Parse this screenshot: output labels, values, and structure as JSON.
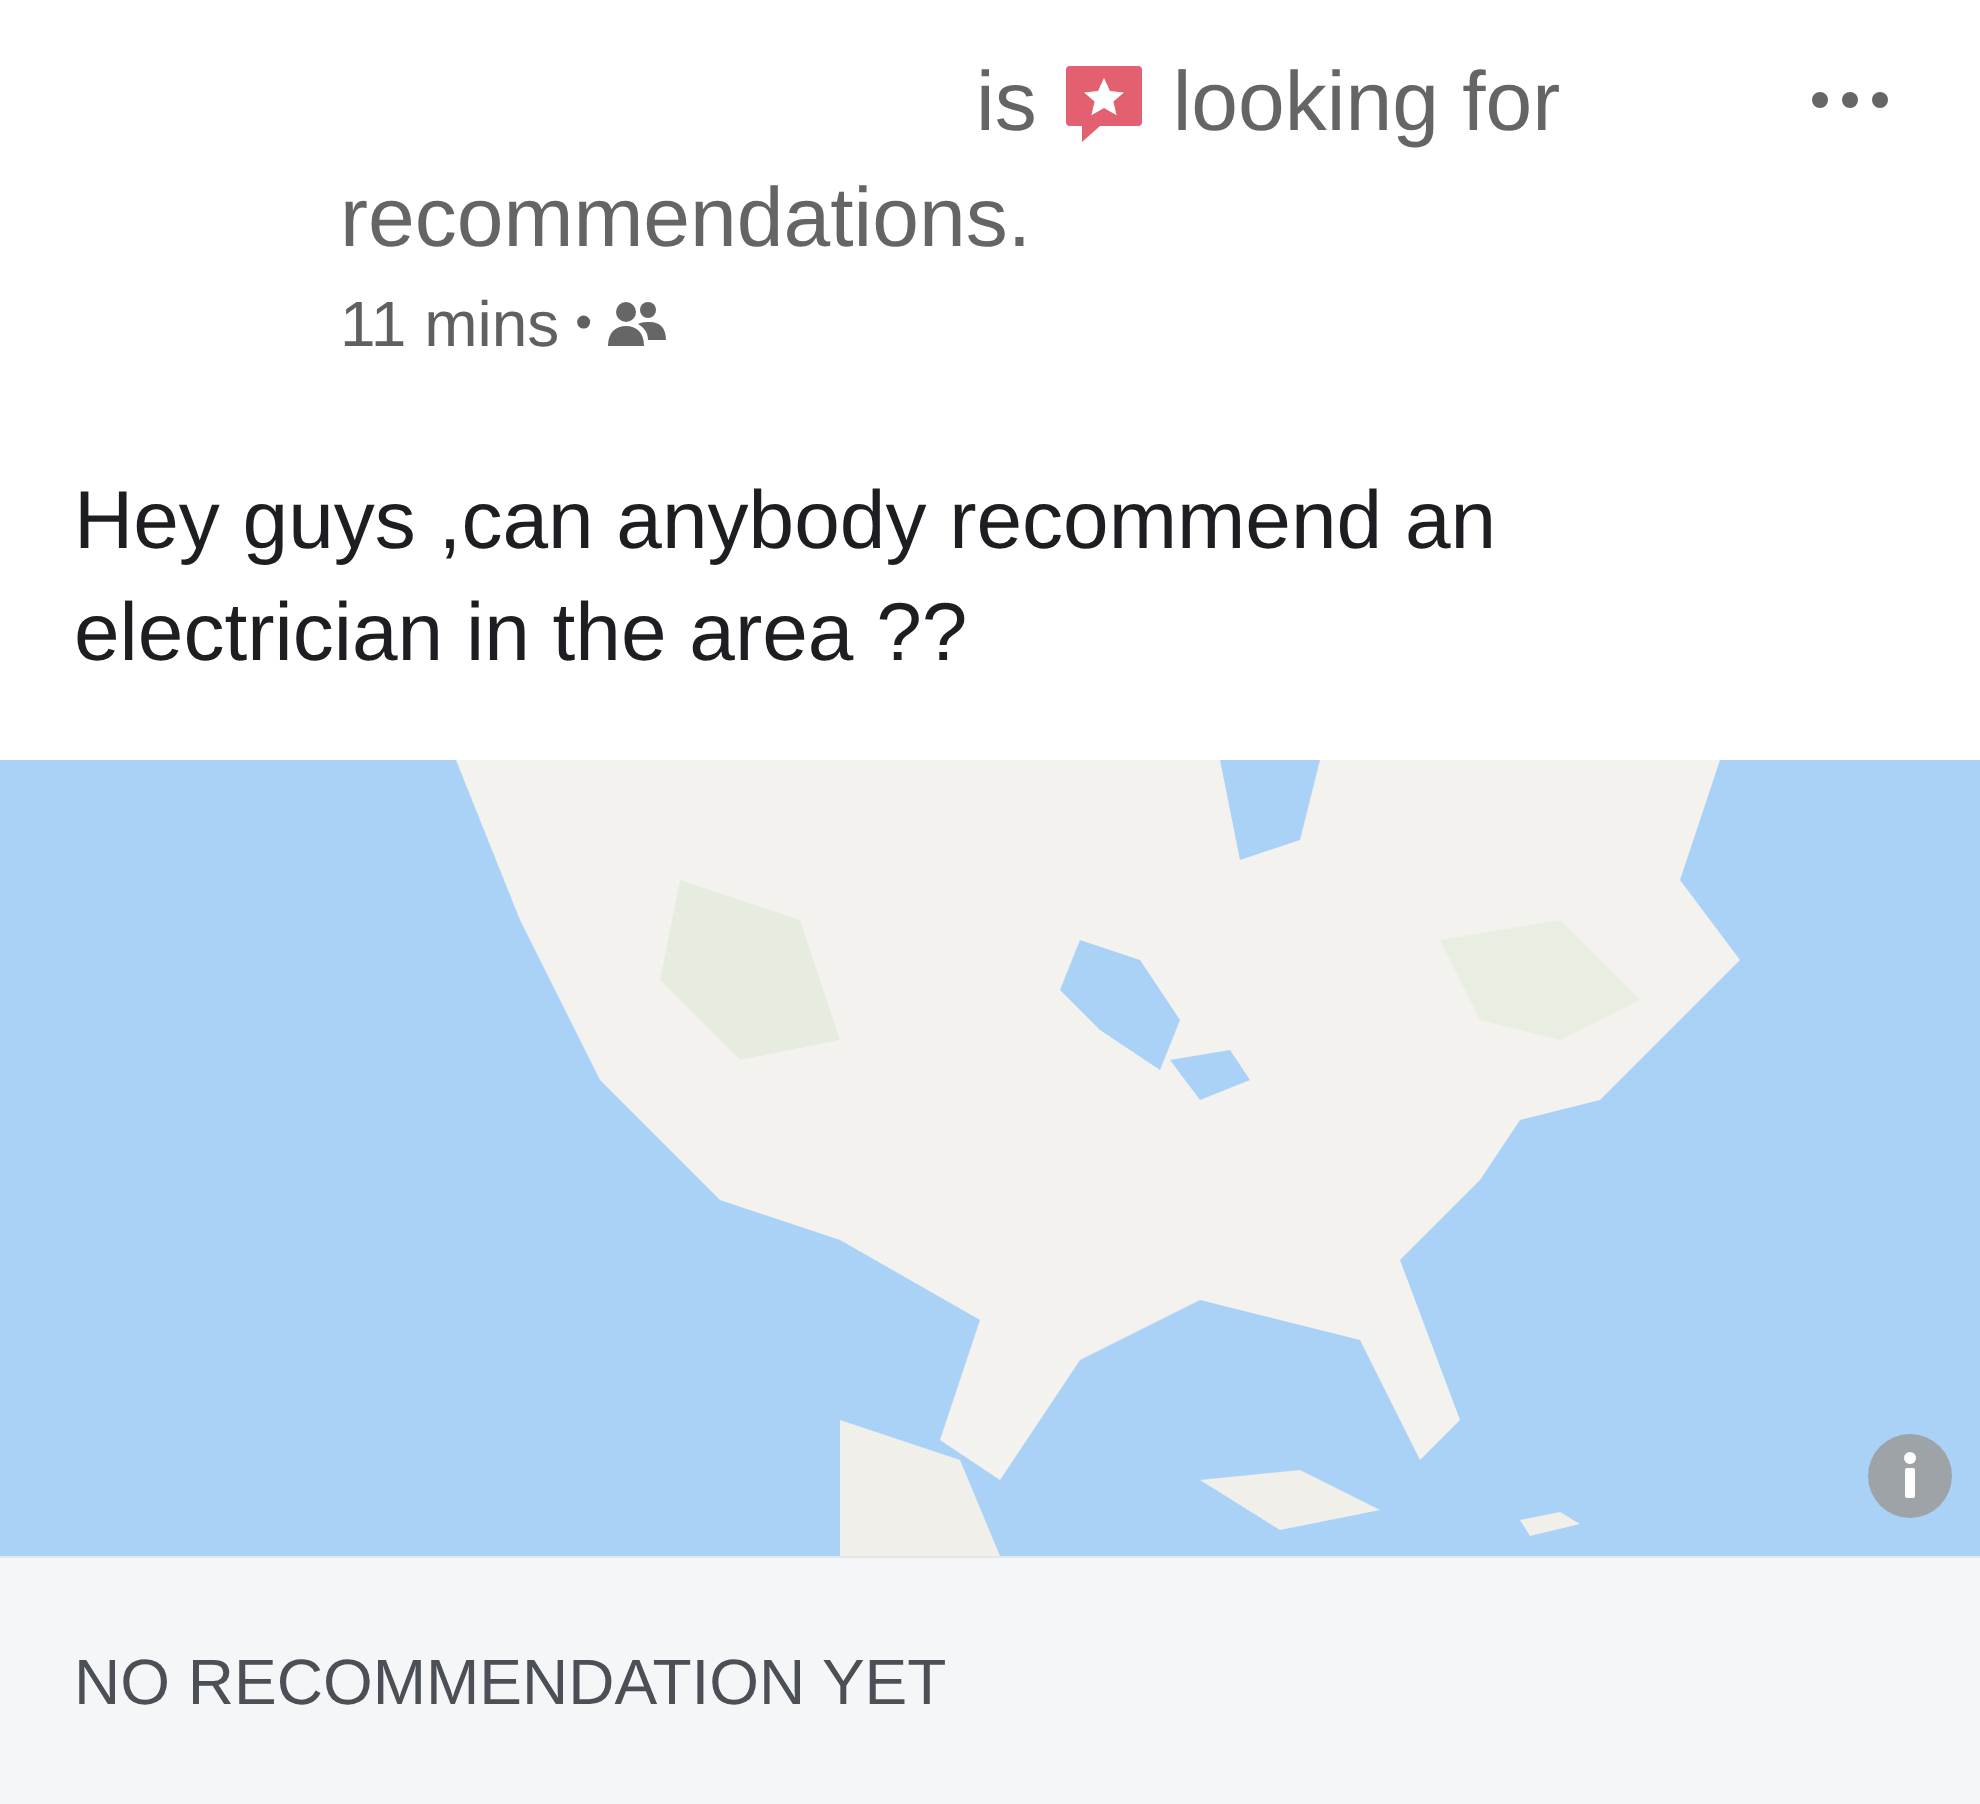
{
  "post": {
    "header": {
      "verb": "is",
      "phrase": "looking for",
      "continued": "recommendations."
    },
    "meta": {
      "time": "11 mins",
      "separator": "•"
    },
    "body": "Hey guys ,can anybody recommend an electrician in the area ??",
    "footer": {
      "status": "NO RECOMMENDATION YET"
    }
  }
}
